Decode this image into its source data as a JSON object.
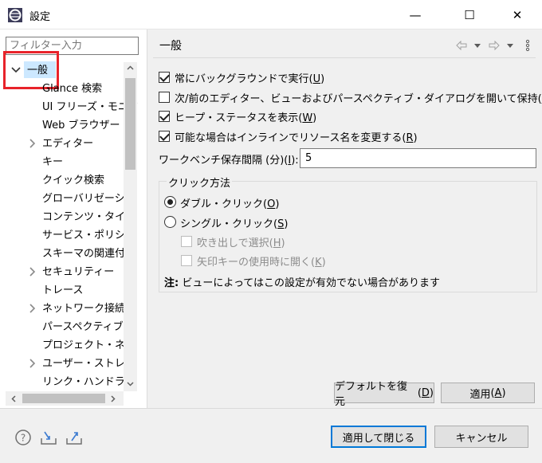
{
  "window": {
    "title": "設定",
    "minimize": "—",
    "maximize": "☐",
    "close": "✕"
  },
  "sidebar": {
    "filter_placeholder": "フィルター入力",
    "items": [
      {
        "label": "一般",
        "expanded": true,
        "selected": true
      },
      {
        "label": "Glance 検索"
      },
      {
        "label": "UI フリーズ・モニタ"
      },
      {
        "label": "Web ブラウザー"
      },
      {
        "label": "エディター",
        "collapsible": true
      },
      {
        "label": "キー"
      },
      {
        "label": "クイック検索"
      },
      {
        "label": "グローバリゼーショ"
      },
      {
        "label": "コンテンツ・タイプ"
      },
      {
        "label": "サービス・ポリシー"
      },
      {
        "label": "スキーマの関連付"
      },
      {
        "label": "セキュリティー",
        "collapsible": true
      },
      {
        "label": "トレース"
      },
      {
        "label": "ネットワーク接続",
        "collapsible": true
      },
      {
        "label": "パースペクティブ"
      },
      {
        "label": "プロジェクト・ネー"
      },
      {
        "label": "ユーザー・ストレー",
        "collapsible": true
      },
      {
        "label": "リンク・ハンドラー"
      }
    ]
  },
  "main": {
    "title": "一般",
    "options": [
      {
        "label": "常にバックグラウンドで実行",
        "key": "U",
        "checked": true
      },
      {
        "label": "次/前のエディター、ビューおよびパースペクティブ・ダイアログを開いて保持",
        "key": "N",
        "checked": false
      },
      {
        "label": "ヒープ・ステータスを表示",
        "key": "W",
        "checked": true
      },
      {
        "label": "可能な場合はインラインでリソース名を変更する",
        "key": "R",
        "checked": true
      }
    ],
    "interval_label": "ワークベンチ保存間隔 (分)",
    "interval_key": "I",
    "interval_value": "5",
    "click_group": {
      "title": "クリック方法",
      "double_click": "ダブル・クリック",
      "double_key": "O",
      "single_click": "シングル・クリック",
      "single_key": "S",
      "hover_select": "吹き出しで選択",
      "hover_key": "H",
      "arrow_open": "矢印キーの使用時に開く",
      "arrow_key": "K"
    },
    "note_prefix": "注:",
    "note_text": "ビューによってはこの設定が有効でない場合があります",
    "restore_defaults": "デフォルトを復元",
    "restore_key": "D",
    "apply": "適用",
    "apply_key": "A"
  },
  "footer": {
    "apply_close": "適用して閉じる",
    "cancel": "キャンセル"
  }
}
